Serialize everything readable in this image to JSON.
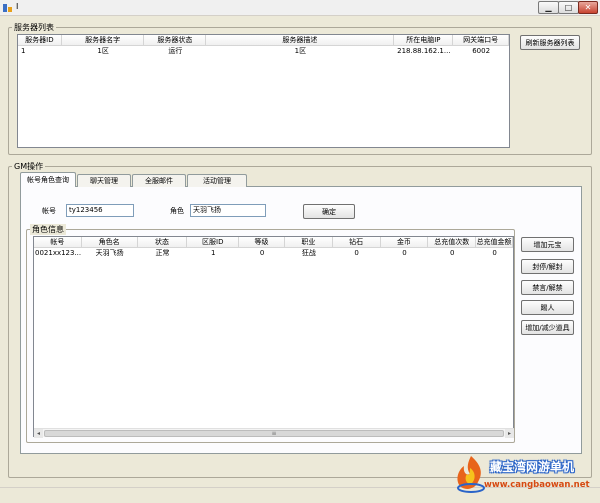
{
  "window": {
    "title": "I",
    "minimize_glyph": "▁",
    "maximize_glyph": "□",
    "close_glyph": "✕"
  },
  "server_group": {
    "title": "服务器列表",
    "columns": [
      "服务器ID",
      "服务器名字",
      "服务器状态",
      "服务器描述",
      "所在电脑IP",
      "网关端口号"
    ],
    "rows": [
      [
        "1",
        "1区",
        "运行",
        "1区",
        "218.88.162.1...",
        "6002"
      ]
    ],
    "refresh_button": "刷新服务器列表"
  },
  "gm_group": {
    "title": "GM操作",
    "tabs": [
      "帐号角色查询",
      "聊天管理",
      "全服邮件",
      "活动管理"
    ],
    "account_label": "帐号",
    "account_value": "ty123456",
    "role_label": "角色",
    "role_value": "天羽飞扬",
    "confirm_button": "确定"
  },
  "role_info": {
    "title": "角色信息",
    "columns": [
      "帐号",
      "角色名",
      "状态",
      "区服ID",
      "等级",
      "职业",
      "钻石",
      "金币",
      "总充值次数",
      "总充值金额"
    ],
    "rows": [
      [
        "0021xx123...",
        "天羽飞扬",
        "正常",
        "1",
        "0",
        "狂战",
        "0",
        "0",
        "0",
        "0"
      ]
    ],
    "scroll_left": "◂",
    "scroll_right": "▸",
    "scroll_thumb": "≡",
    "side_buttons": [
      "增加元宝",
      "封停/解封",
      "禁言/解禁",
      "踢人",
      "增加/减少道具"
    ]
  },
  "watermark": {
    "line1": "藏宝湾网游单机",
    "line2": "www.cangbaowan.net"
  }
}
